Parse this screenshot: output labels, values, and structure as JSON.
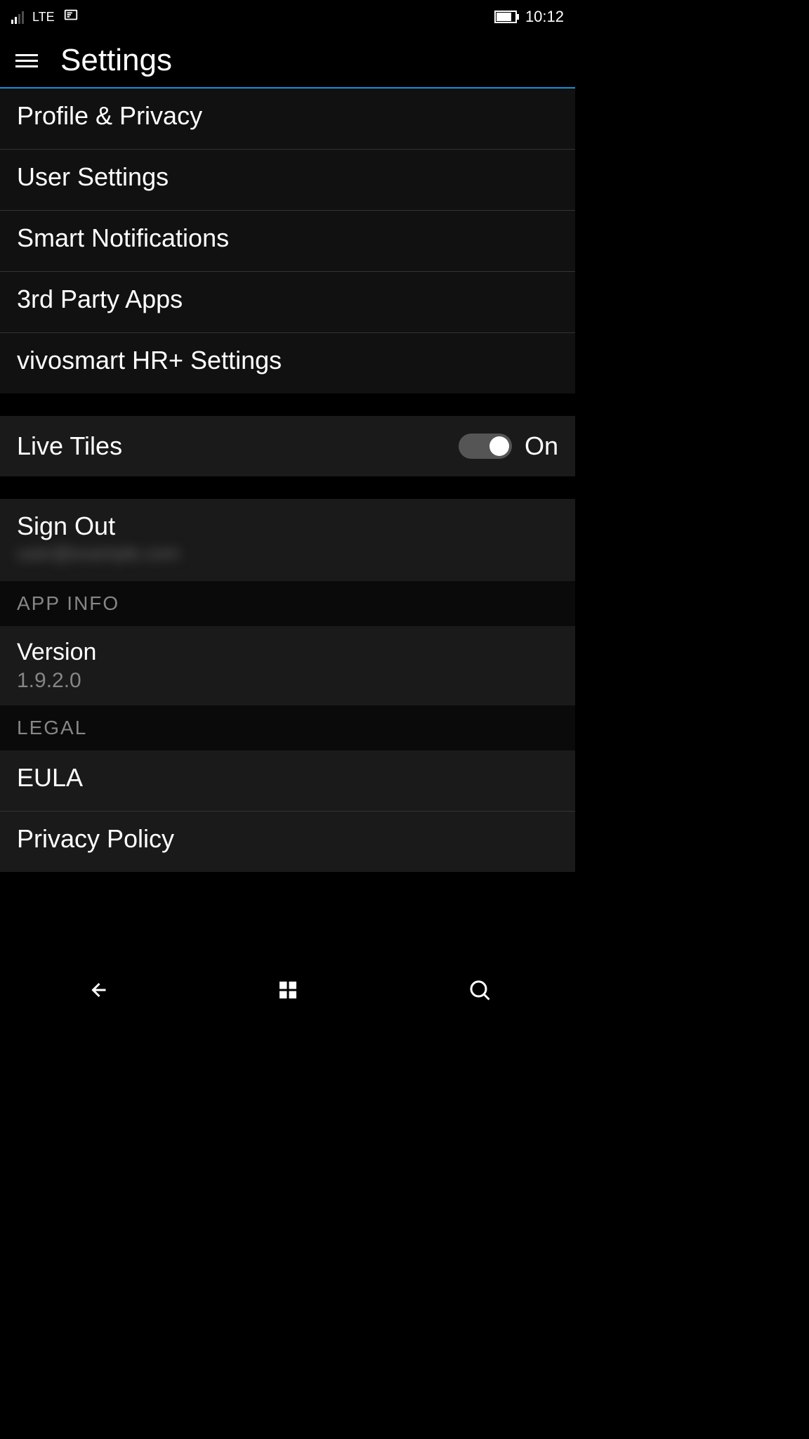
{
  "status_bar": {
    "network_type": "LTE",
    "time": "10:12"
  },
  "header": {
    "title": "Settings"
  },
  "settings_list": {
    "items": [
      "Profile & Privacy",
      "User Settings",
      "Smart Notifications",
      "3rd Party Apps",
      "vivosmart HR+ Settings"
    ]
  },
  "live_tiles": {
    "label": "Live Tiles",
    "state": "On"
  },
  "sign_out": {
    "label": "Sign Out",
    "subtitle": "user@example.com"
  },
  "sections": {
    "app_info_header": "APP INFO",
    "legal_header": "LEGAL"
  },
  "version": {
    "label": "Version",
    "value": "1.9.2.0"
  },
  "legal_items": {
    "eula": "EULA",
    "privacy_policy": "Privacy Policy"
  }
}
